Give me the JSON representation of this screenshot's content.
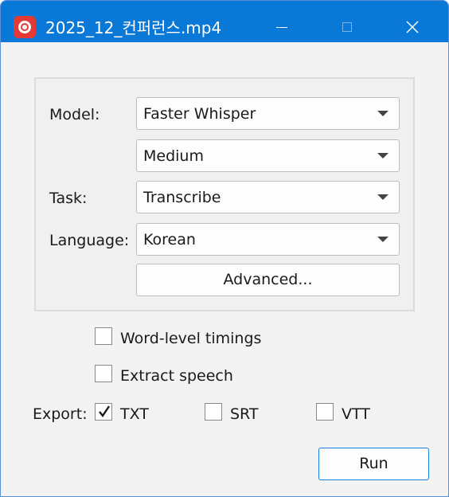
{
  "window": {
    "title": "2025_12_컨퍼런스.mp4",
    "accent_color": "#0a78d7",
    "app_icon": "record-icon"
  },
  "form": {
    "model_label": "Model:",
    "model_value": "Faster Whisper",
    "model_size_value": "Medium",
    "task_label": "Task:",
    "task_value": "Transcribe",
    "language_label": "Language:",
    "language_value": "Korean",
    "advanced_label": "Advanced..."
  },
  "options": {
    "word_timings_label": "Word-level timings",
    "word_timings_checked": false,
    "extract_speech_label": "Extract speech",
    "extract_speech_checked": false
  },
  "export": {
    "label": "Export:",
    "formats": [
      {
        "label": "TXT",
        "checked": true
      },
      {
        "label": "SRT",
        "checked": false
      },
      {
        "label": "VTT",
        "checked": false
      }
    ]
  },
  "actions": {
    "run_label": "Run"
  }
}
